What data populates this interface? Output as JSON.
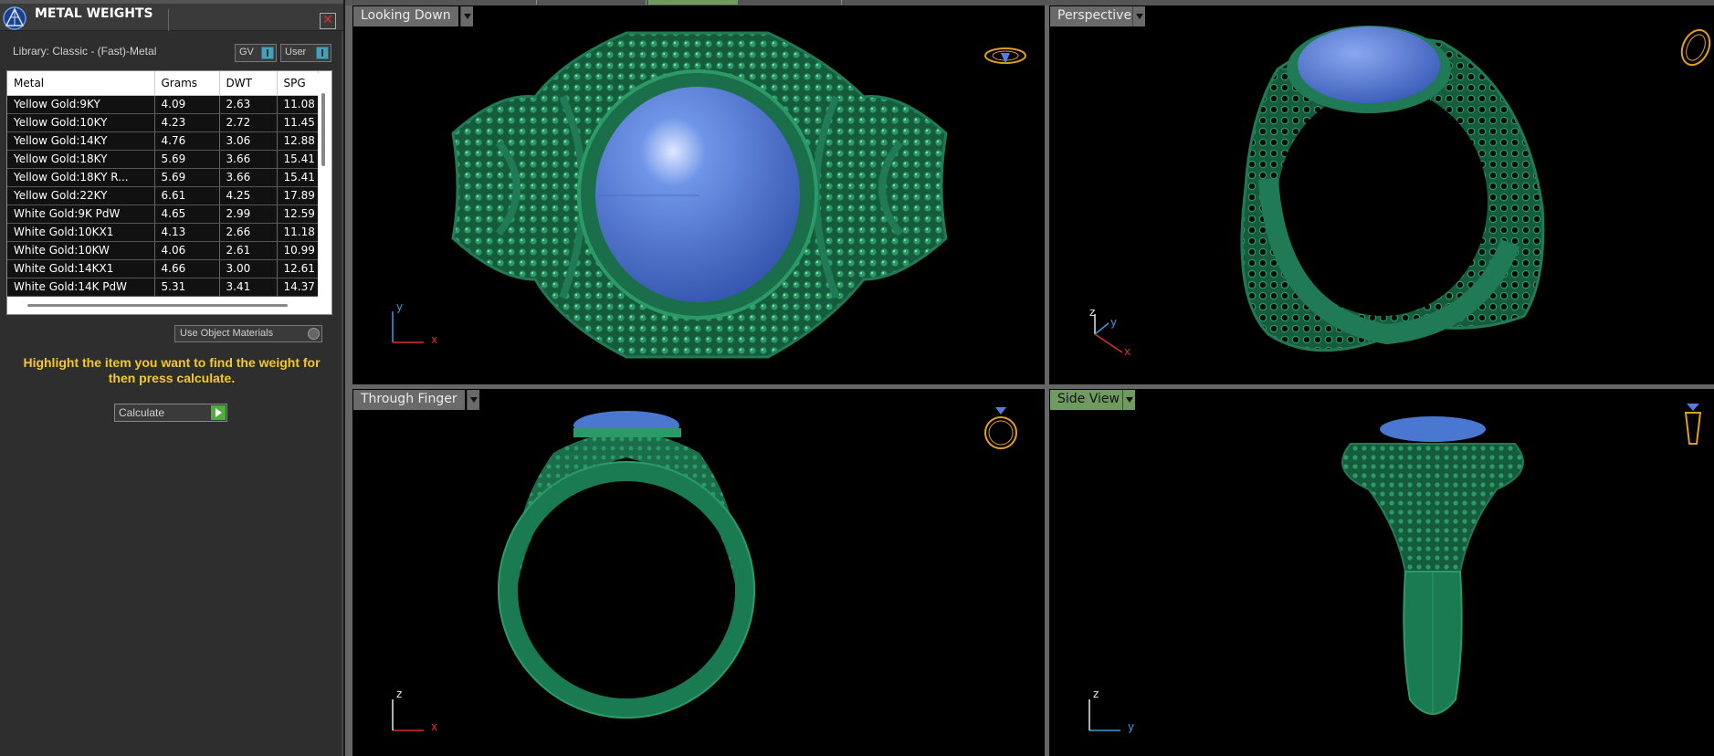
{
  "panel": {
    "title": "METAL WEIGHTS",
    "close_icon": "close-x-icon",
    "library_label": "Library: Classic - (Fast)-Metal",
    "gv_label": "GV",
    "user_label": "User",
    "use_object_materials_label": "Use Object Materials",
    "instructions": "Highlight the item you want to find the weight for then press calculate.",
    "calculate_label": "Calculate",
    "accent_color": "#f2c82a"
  },
  "metal_table": {
    "headers": [
      "Metal",
      "Grams",
      "DWT",
      "SPG"
    ],
    "rows": [
      [
        "Yellow Gold:9KY",
        "4.09",
        "2.63",
        "11.08"
      ],
      [
        "Yellow Gold:10KY",
        "4.23",
        "2.72",
        "11.45"
      ],
      [
        "Yellow Gold:14KY",
        "4.76",
        "3.06",
        "12.88"
      ],
      [
        "Yellow Gold:18KY",
        "5.69",
        "3.66",
        "15.41"
      ],
      [
        "Yellow Gold:18KY R...",
        "5.69",
        "3.66",
        "15.41"
      ],
      [
        "Yellow Gold:22KY",
        "6.61",
        "4.25",
        "17.89"
      ],
      [
        "White Gold:9K PdW",
        "4.65",
        "2.99",
        "12.59"
      ],
      [
        "White Gold:10KX1",
        "4.13",
        "2.66",
        "11.18"
      ],
      [
        "White Gold:10KW",
        "4.06",
        "2.61",
        "10.99"
      ],
      [
        "White Gold:14KX1",
        "4.66",
        "3.00",
        "12.61"
      ],
      [
        "White Gold:14K PdW",
        "5.31",
        "3.41",
        "14.37"
      ]
    ]
  },
  "viewports": {
    "looking_down": "Looking Down",
    "perspective": "Perspective",
    "through_finger": "Through Finger",
    "side_view": "Side View"
  },
  "axes": {
    "x": "x",
    "y": "y",
    "z": "z"
  },
  "colors": {
    "ring_metal": "#1f7a55",
    "gemstone": "#4a78d0",
    "axis_x": "#d83030",
    "axis_y": "#3a9ae0",
    "nav_cube": "#e0a020"
  }
}
